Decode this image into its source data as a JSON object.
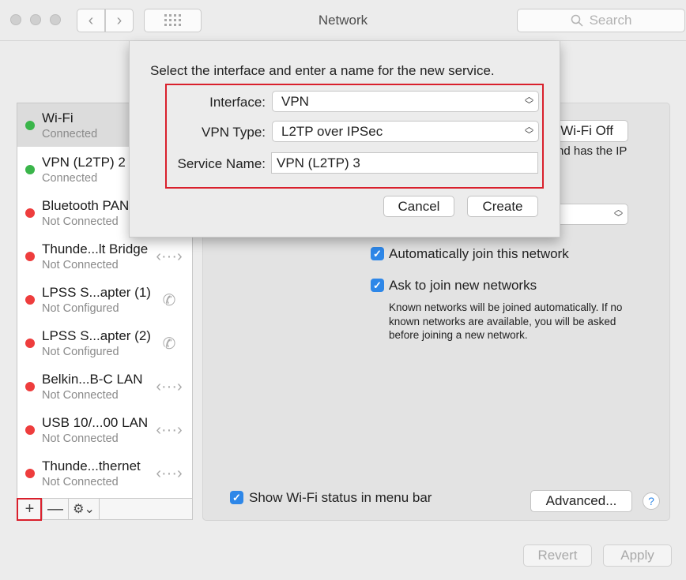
{
  "window": {
    "title": "Network"
  },
  "toolbar": {
    "back_icon": "chevron-left",
    "forward_icon": "chevron-right",
    "grid_icon": "grid",
    "search_placeholder": "Search"
  },
  "sidebar": {
    "services": [
      {
        "name": "Wi-Fi",
        "status": "Connected",
        "status_color": "#3ab54a",
        "icon": ""
      },
      {
        "name": "VPN (L2TP) 2",
        "status": "Connected",
        "status_color": "#3ab54a",
        "icon": ""
      },
      {
        "name": "Bluetooth PAN",
        "status": "Not Connected",
        "status_color": "#ee3d3d",
        "icon": "bluetooth"
      },
      {
        "name": "Thunde...lt Bridge",
        "status": "Not Connected",
        "status_color": "#ee3d3d",
        "icon": "ethernet"
      },
      {
        "name": "LPSS S...apter (1)",
        "status": "Not Configured",
        "status_color": "#ee3d3d",
        "icon": "phone"
      },
      {
        "name": "LPSS S...apter (2)",
        "status": "Not Configured",
        "status_color": "#ee3d3d",
        "icon": "phone"
      },
      {
        "name": "Belkin...B-C LAN",
        "status": "Not Connected",
        "status_color": "#ee3d3d",
        "icon": "ethernet"
      },
      {
        "name": "USB 10/...00 LAN",
        "status": "Not Connected",
        "status_color": "#ee3d3d",
        "icon": "ethernet"
      },
      {
        "name": "Thunde...thernet",
        "status": "Not Connected",
        "status_color": "#ee3d3d",
        "icon": "ethernet"
      }
    ],
    "add_label": "+",
    "remove_label": "—",
    "gear_label": "⚙︎⌄"
  },
  "main": {
    "wifi_off_label": "Wi-Fi Off",
    "status_text_partial": "nd has the IP",
    "auto_join_label": "Automatically join this network",
    "ask_join_label": "Ask to join new networks",
    "ask_join_desc": "Known networks will be joined automatically. If no known networks are available, you will be asked before joining a new network.",
    "show_status_label": "Show Wi-Fi status in menu bar",
    "advanced_label": "Advanced...",
    "help_label": "?"
  },
  "dialog": {
    "prompt": "Select the interface and enter a name for the new service.",
    "interface_label": "Interface:",
    "interface_value": "VPN",
    "vpn_type_label": "VPN Type:",
    "vpn_type_value": "L2TP over IPSec",
    "service_name_label": "Service Name:",
    "service_name_value": "VPN (L2TP) 3",
    "cancel_label": "Cancel",
    "create_label": "Create"
  },
  "footer": {
    "revert_label": "Revert",
    "apply_label": "Apply"
  },
  "colors": {
    "accent": "#2e87e8",
    "highlight": "#d9202c",
    "connected": "#3ab54a",
    "disconnected": "#ee3d3d"
  }
}
